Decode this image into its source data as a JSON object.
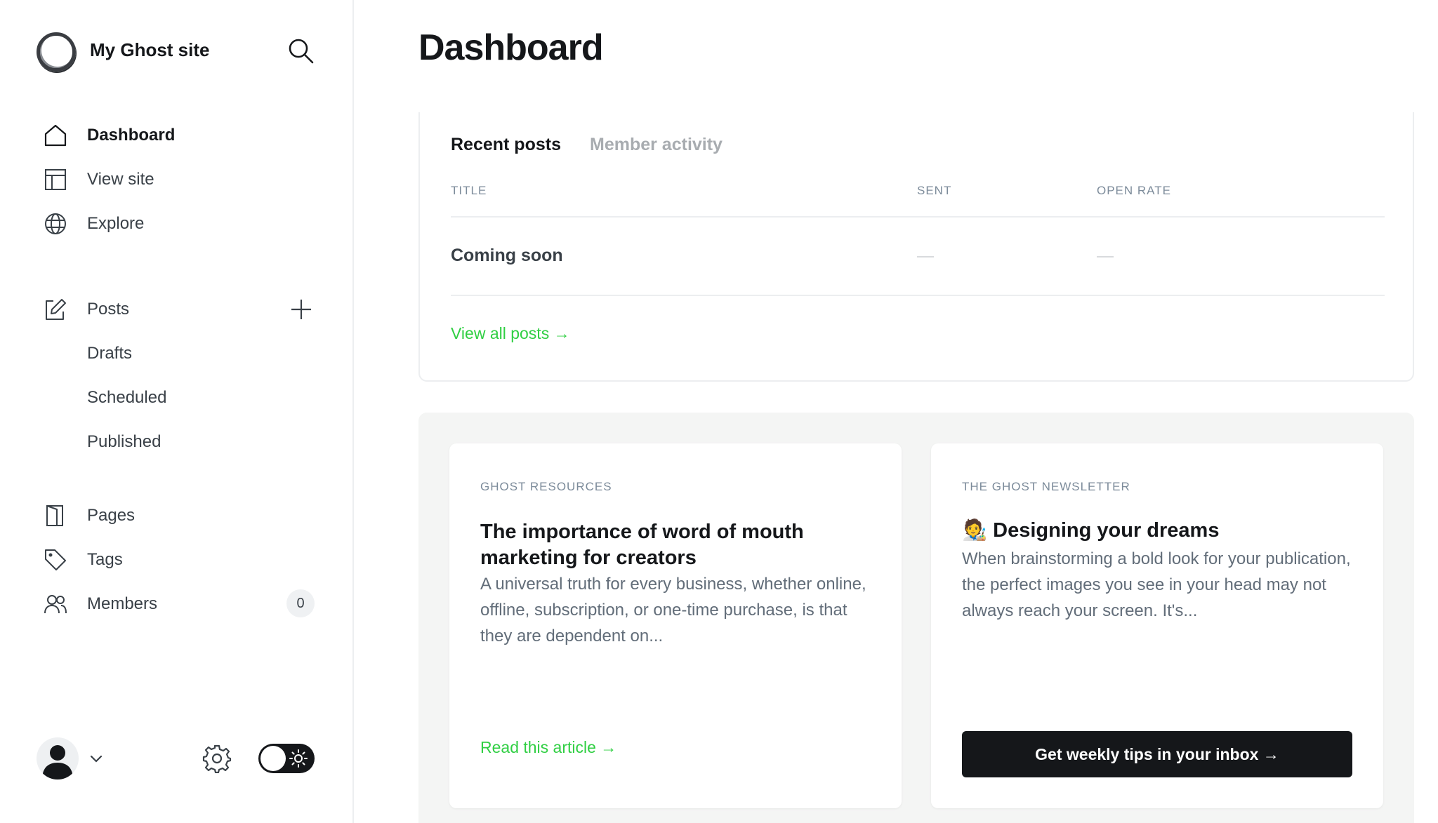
{
  "site": {
    "title": "My Ghost site"
  },
  "nav": {
    "dashboard": "Dashboard",
    "view_site": "View site",
    "explore": "Explore",
    "posts": "Posts",
    "drafts": "Drafts",
    "scheduled": "Scheduled",
    "published": "Published",
    "pages": "Pages",
    "tags": "Tags",
    "members": "Members",
    "members_count": "0"
  },
  "main": {
    "title": "Dashboard",
    "tabs": {
      "recent": "Recent posts",
      "activity": "Member activity"
    },
    "table": {
      "headers": {
        "title": "TITLE",
        "sent": "SENT",
        "open_rate": "OPEN RATE"
      },
      "rows": [
        {
          "title": "Coming soon",
          "sent": "—",
          "open_rate": "—"
        }
      ]
    },
    "view_all": "View all posts →"
  },
  "resources": {
    "left": {
      "eyebrow": "GHOST RESOURCES",
      "title": "The importance of word of mouth marketing for creators",
      "excerpt": "A universal truth for every business, whether online, offline, subscription, or one-time purchase, is that they are dependent on...",
      "link": "Read this article →"
    },
    "right": {
      "eyebrow": "THE GHOST NEWSLETTER",
      "title": "🧑‍🎨 Designing your dreams",
      "excerpt": "When brainstorming a bold look for your publication, the perfect images you see in your head may not always reach your screen. It's...",
      "button": "Get weekly tips in your inbox →"
    }
  },
  "colors": {
    "accent": "#30cf43",
    "dark": "#15171a",
    "muted": "#7c8b9a"
  }
}
